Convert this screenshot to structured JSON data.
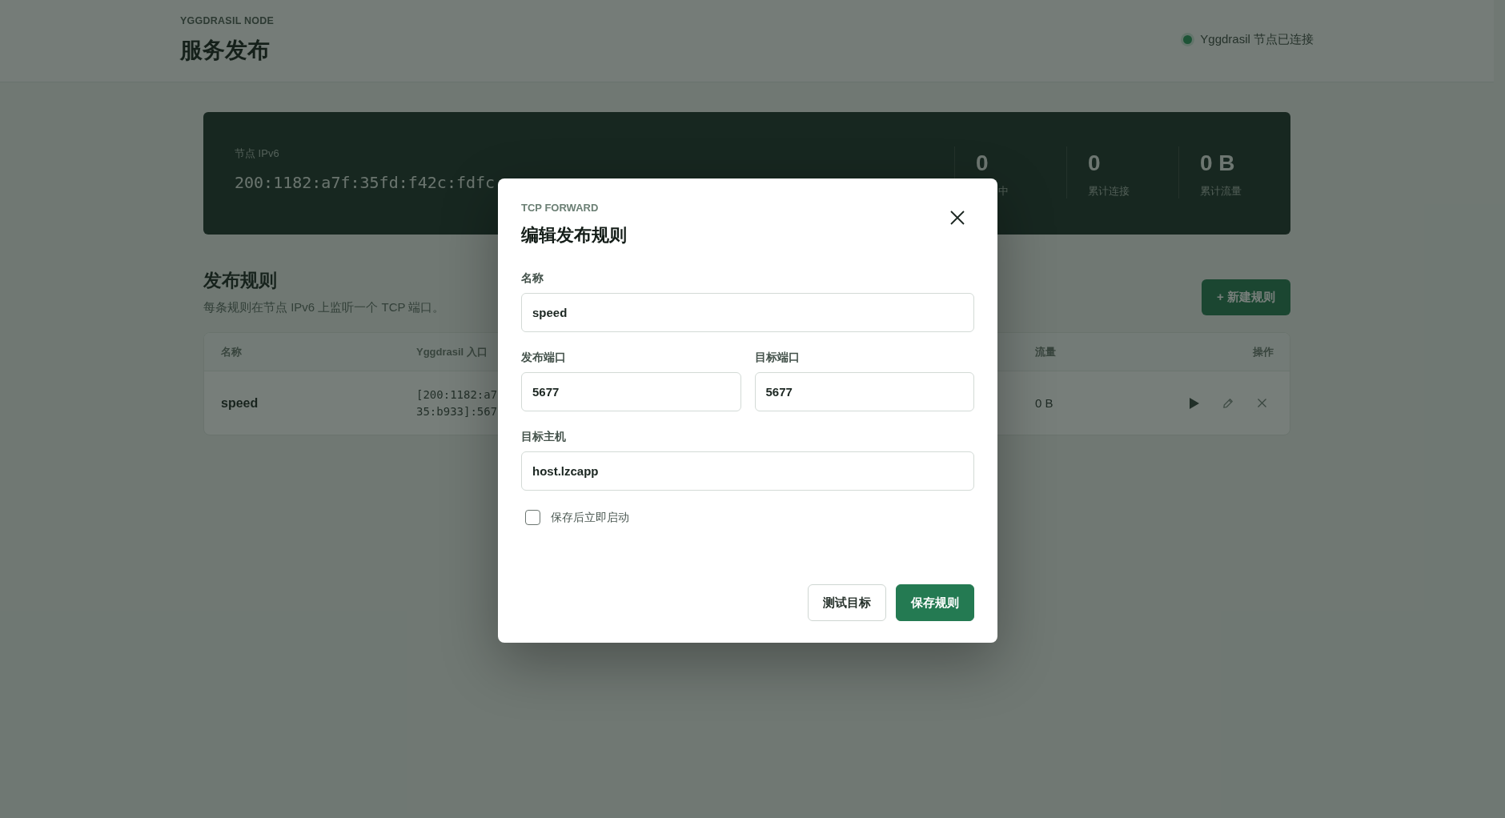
{
  "header": {
    "eyebrow": "YGGDRASIL NODE",
    "title": "服务发布",
    "status": {
      "text": "Yggdrasil 节点已连接",
      "connected": true
    }
  },
  "node_panel": {
    "label": "节点 IPv6",
    "address": "200:1182:a7f:35fd:f42c:fdfc",
    "stats": [
      {
        "value": "0",
        "label": "中"
      },
      {
        "value": "0",
        "label": "累计连接"
      },
      {
        "value": "0 B",
        "label": "累计流量"
      }
    ]
  },
  "rules_section": {
    "title": "发布规则",
    "subtitle": "每条规则在节点 IPv6 上监听一个 TCP 端口。",
    "new_button": "+ 新建规则"
  },
  "table": {
    "columns": [
      {
        "label": "名称"
      },
      {
        "label": "Yggdrasil 入口"
      },
      {
        "label": "流量"
      },
      {
        "label": "操作"
      }
    ],
    "rows": [
      {
        "name": "speed",
        "entry": "[200:1182:a7\n35:b933]:567",
        "traffic": "0 B"
      }
    ]
  },
  "modal": {
    "eyebrow": "TCP FORWARD",
    "title": "编辑发布规则",
    "field_rows": [
      [
        {
          "label": "名称",
          "value": "speed"
        }
      ],
      [
        {
          "label": "发布端口",
          "value": "5677"
        },
        {
          "label": "目标端口",
          "value": "5677"
        }
      ],
      [
        {
          "label": "目标主机",
          "value": "host.lzcapp"
        }
      ]
    ],
    "start_after_save": {
      "label": "保存后立即启动",
      "checked": false
    },
    "buttons": [
      {
        "label": "测试目标",
        "kind": "secondary"
      },
      {
        "label": "保存规则",
        "kind": "primary"
      }
    ]
  }
}
